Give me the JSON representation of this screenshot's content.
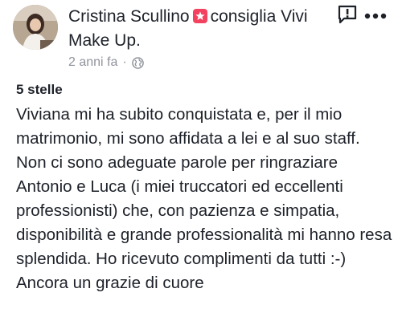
{
  "post": {
    "author": "Cristina Scullino",
    "action": "consiglia Vivi",
    "page_name": "Make Up.",
    "time": "2 anni fa",
    "separator": "·",
    "audience_icon": "globe-icon",
    "recommend_icon": "recommend-icon",
    "report_icon": "report-icon",
    "more_icon": "more-options-icon"
  },
  "review": {
    "rating": "5 stelle",
    "text": "Viviana mi ha subito conquistata e, per il mio matrimonio, mi sono affidata a lei e al suo staff. Non ci sono adeguate parole per ringraziare  Antonio e Luca (i miei truccatori ed eccellenti professionisti) che, con pazienza e simpatia, disponibilità e grande professionalità mi hanno resa splendida. Ho ricevuto complimenti da tutti :-) Ancora un grazie di cuore"
  },
  "colors": {
    "text": "#1d2129",
    "muted": "#90949c",
    "recommend": "#f3425f"
  }
}
